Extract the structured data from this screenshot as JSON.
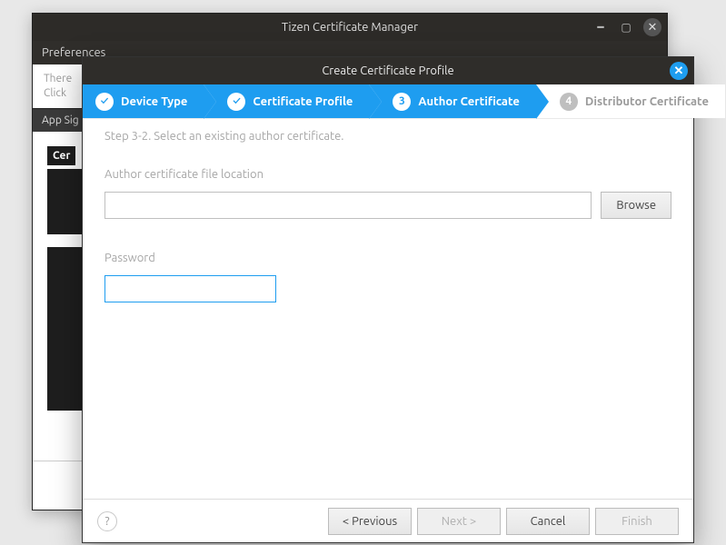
{
  "parent": {
    "title": "Tizen Certificate Manager",
    "prefs": "Preferences",
    "hint_line1": "There",
    "hint_line2": "Click",
    "tab": "App Sig",
    "cert_label": "Cer"
  },
  "dialog": {
    "title": "Create Certificate Profile",
    "close_glyph": "✕"
  },
  "steps": {
    "s1": {
      "label": "Device Type",
      "badge": "✓"
    },
    "s2": {
      "label": "Certificate Profile",
      "badge": "✓"
    },
    "s3": {
      "label": "Author Certificate",
      "badge": "3"
    },
    "s4": {
      "label": "Distributor Certificate",
      "badge": "4"
    }
  },
  "step_desc": "Step 3-2. Select an existing author certificate.",
  "form": {
    "file_label": "Author certificate file location",
    "file_value": "",
    "browse": "Browse",
    "password_label": "Password",
    "password_value": ""
  },
  "footer": {
    "help": "?",
    "prev": "< Previous",
    "next": "Next >",
    "cancel": "Cancel",
    "finish": "Finish"
  }
}
